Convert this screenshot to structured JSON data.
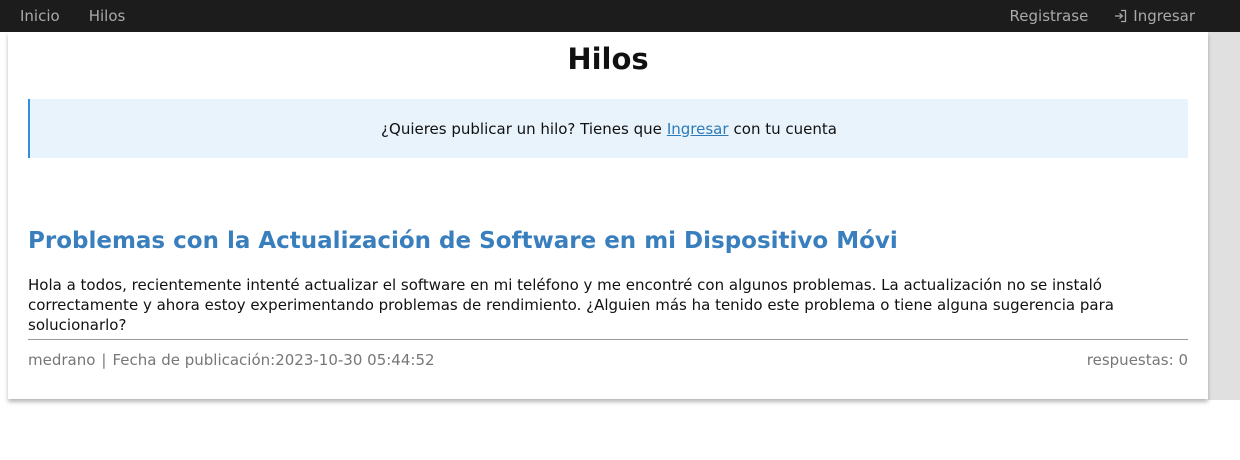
{
  "nav": {
    "home_label": "Inicio",
    "threads_label": "Hilos",
    "register_label": "Registrase",
    "login_label": "Ingresar"
  },
  "page": {
    "title": "Hilos"
  },
  "notice": {
    "text_before": "¿Quieres publicar un hilo? Tienes que",
    "link_label": "Ingresar",
    "text_after": "con tu cuenta"
  },
  "thread": {
    "title": "Problemas con la Actualización de Software en mi Dispositivo Móvi",
    "body": "Hola a todos, recientemente intenté actualizar el software en mi teléfono y me encontré con algunos problemas. La actualización no se instaló correctamente y ahora estoy experimentando problemas de rendimiento. ¿Alguien más ha tenido este problema o tiene alguna sugerencia para solucionarlo?",
    "author": "medrano",
    "separator": "|",
    "date_label": "Fecha de publicación:",
    "date": "2023-10-30 05:44:52",
    "replies_label": "respuestas: 0"
  },
  "icons": {
    "login": "login-icon"
  },
  "colors": {
    "navbar_bg": "#1c1c1c",
    "nav_text": "#a9a9a9",
    "link_blue": "#3a7fbd",
    "notice_bg": "#e8f3fc",
    "notice_border": "#2e8fe0"
  }
}
